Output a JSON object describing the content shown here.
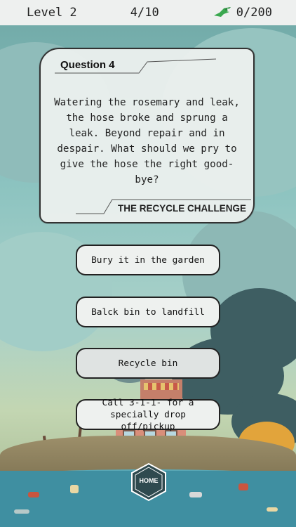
{
  "hud": {
    "level": "Level 2",
    "progress": "4/10",
    "score": "0/200",
    "score_icon": "green-bird-icon"
  },
  "question": {
    "title": "Question 4",
    "text": "Watering the rosemary and leak, the hose broke and sprung a leak. Beyond repair and in despair. What should we pry to give the hose the right good-bye?",
    "footer": "THE RECYCLE CHALLENGE"
  },
  "answers": [
    {
      "label": "Bury it in the garden"
    },
    {
      "label": "Balck bin to landfill"
    },
    {
      "label": "Recycle bin"
    },
    {
      "label": "Call 3-1-1- for a specially drop off/pickup"
    }
  ],
  "home": {
    "label": "HOME"
  },
  "colors": {
    "card_bg": "#eceeed",
    "button_bg": "#eef1ef",
    "border": "#222222",
    "sky": "#7fb4b2",
    "smoke": "#3e5e62"
  }
}
